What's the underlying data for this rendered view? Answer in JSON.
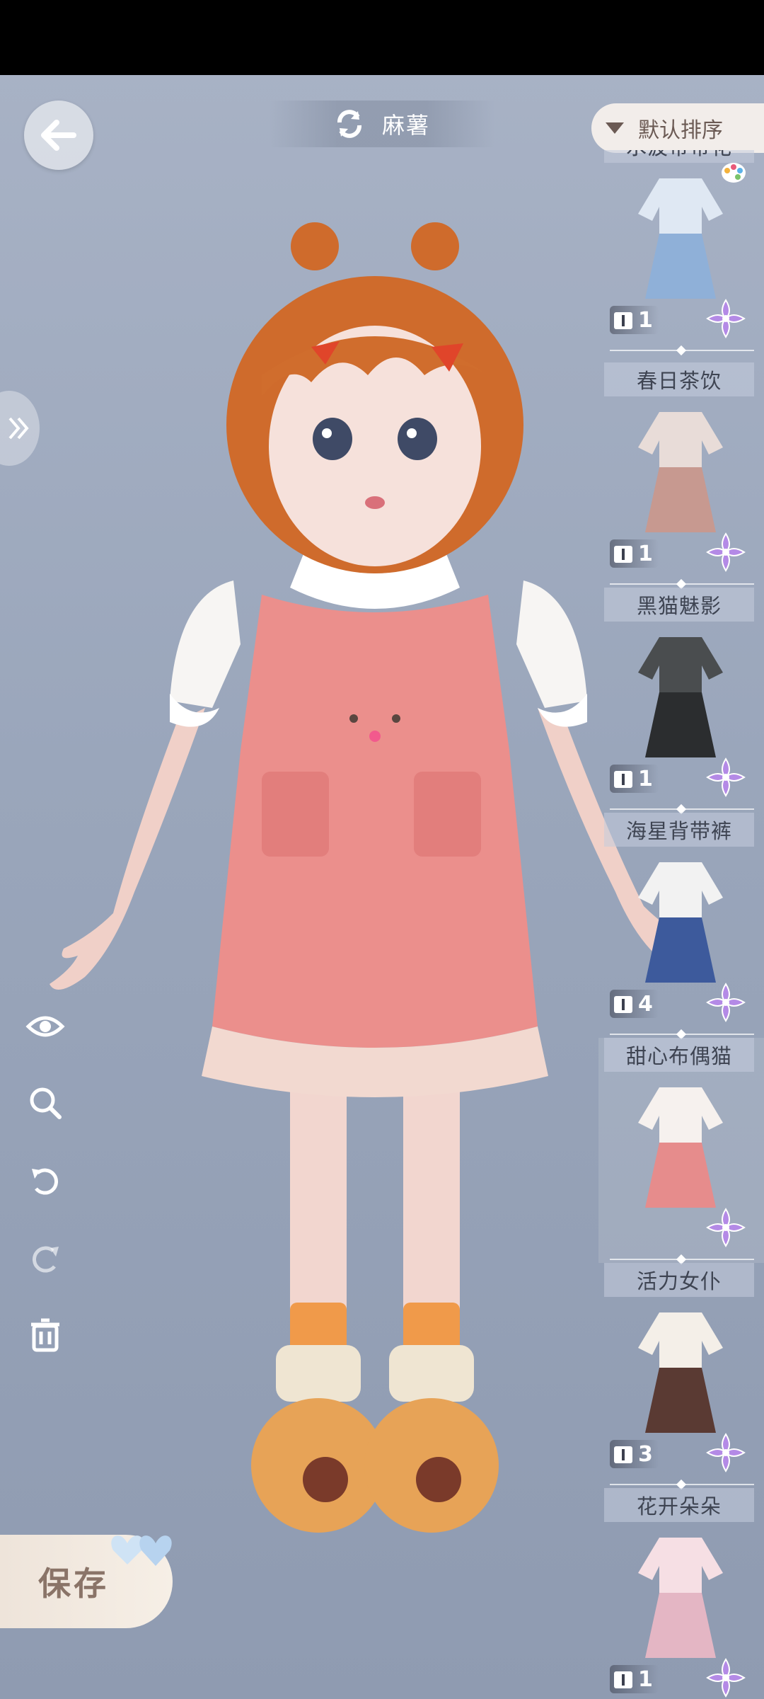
{
  "header": {
    "character_name": "麻薯"
  },
  "sort": {
    "label": "默认排序"
  },
  "tools": [
    {
      "name": "eye-icon"
    },
    {
      "name": "zoom-icon"
    },
    {
      "name": "undo-icon"
    },
    {
      "name": "redo-icon"
    },
    {
      "name": "trash-icon"
    }
  ],
  "save": {
    "label": "保存"
  },
  "outfits": [
    {
      "title": "水波带带花",
      "count": "1",
      "colors": [
        "#dfe8f3",
        "#8fb0d8"
      ],
      "has_palette": true
    },
    {
      "title": "春日茶饮",
      "count": "1",
      "colors": [
        "#e8dcd8",
        "#c79990"
      ]
    },
    {
      "title": "黑猫魅影",
      "count": "1",
      "colors": [
        "#4a4d4f",
        "#2b2d2f"
      ]
    },
    {
      "title": "海星背带裤",
      "count": "4",
      "colors": [
        "#f2f2f2",
        "#3d5a9c"
      ]
    },
    {
      "title": "甜心布偶猫",
      "count": "",
      "colors": [
        "#f6f1ee",
        "#e68c8c"
      ],
      "selected": true
    },
    {
      "title": "活力女仆",
      "count": "3",
      "colors": [
        "#f4efe8",
        "#5a3a33"
      ]
    },
    {
      "title": "花开朵朵",
      "count": "1",
      "colors": [
        "#f6dfe4",
        "#e4b6c4"
      ]
    }
  ],
  "palette": {
    "accent": "#b48ae6",
    "badge_dark": "#3c404e"
  }
}
